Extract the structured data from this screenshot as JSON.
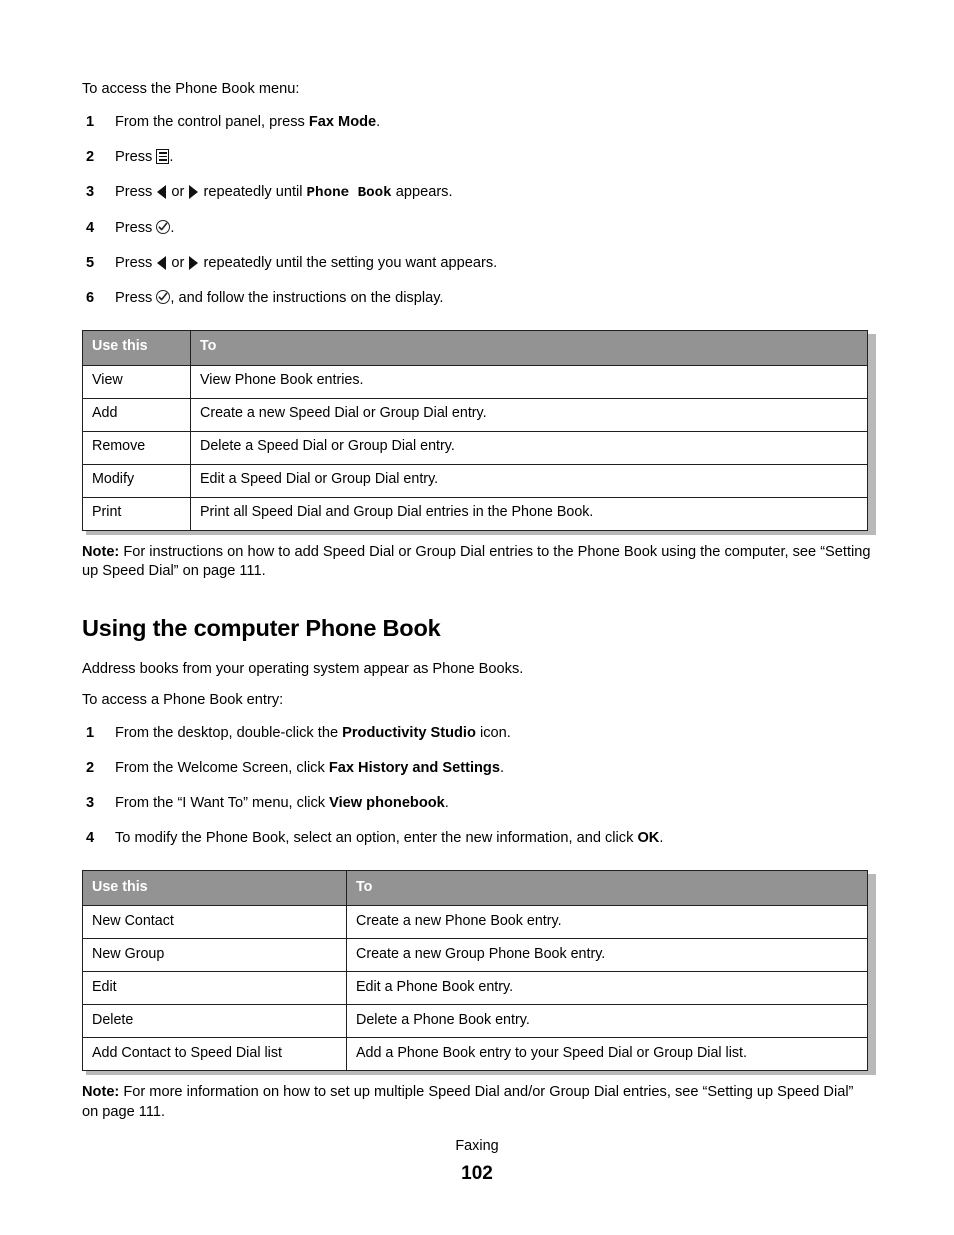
{
  "document": {
    "intro_line": "To access the Phone Book menu:",
    "footer_breadcrumb": "Faxing",
    "footer_page_number": "102",
    "header_fill_color": "#939393",
    "border_color": "#231f20"
  },
  "steps_panel": {
    "items": [
      {
        "num": "1",
        "parts": [
          {
            "type": "text",
            "value": "From the control panel, press "
          },
          {
            "type": "bold",
            "value": "Fax Mode"
          },
          {
            "type": "text",
            "value": "."
          }
        ]
      },
      {
        "num": "2",
        "parts": [
          {
            "type": "text",
            "value": "Press "
          },
          {
            "type": "icon",
            "value": "menu-icon"
          },
          {
            "type": "text",
            "value": "."
          }
        ]
      },
      {
        "num": "3",
        "parts": [
          {
            "type": "text",
            "value": "Press "
          },
          {
            "type": "icon",
            "value": "arrow-left-icon"
          },
          {
            "type": "text",
            "value": " or "
          },
          {
            "type": "icon",
            "value": "arrow-right-icon"
          },
          {
            "type": "text",
            "value": " repeatedly until "
          },
          {
            "type": "mono",
            "value": "Phone  Book"
          },
          {
            "type": "text",
            "value": " appears."
          }
        ]
      },
      {
        "num": "4",
        "parts": [
          {
            "type": "text",
            "value": "Press "
          },
          {
            "type": "icon",
            "value": "select-check-icon"
          },
          {
            "type": "text",
            "value": "."
          }
        ]
      },
      {
        "num": "5",
        "parts": [
          {
            "type": "text",
            "value": "Press "
          },
          {
            "type": "icon",
            "value": "arrow-left-icon"
          },
          {
            "type": "text",
            "value": " or "
          },
          {
            "type": "icon",
            "value": "arrow-right-icon"
          },
          {
            "type": "text",
            "value": " repeatedly until the setting you want appears."
          }
        ]
      },
      {
        "num": "6",
        "parts": [
          {
            "type": "text",
            "value": "Press "
          },
          {
            "type": "icon",
            "value": "select-check-icon"
          },
          {
            "type": "text",
            "value": ", and follow the instructions on the display."
          }
        ]
      }
    ]
  },
  "table_control_panel": {
    "columns": [
      "Use this",
      "To"
    ],
    "rows": [
      [
        "View",
        "View Phone Book entries."
      ],
      [
        "Add",
        "Create a new Speed Dial or Group Dial entry."
      ],
      [
        "Remove",
        "Delete a Speed Dial or Group Dial entry."
      ],
      [
        "Modify",
        "Edit a Speed Dial or Group Dial entry."
      ],
      [
        "Print",
        "Print all Speed Dial and Group Dial entries in the Phone Book."
      ]
    ]
  },
  "note_one": {
    "label": "Note:",
    "text": " For instructions on how to add Speed Dial or Group Dial entries to the Phone Book using the computer, see “Setting up Speed Dial” on page 111."
  },
  "section": {
    "title": "Using the computer Phone Book",
    "body_line": "Address books from your operating system appear as Phone Books.",
    "intro_line": "To access a Phone Book entry:"
  },
  "computer_steps_panel": {
    "items": [
      {
        "num": "1",
        "parts": [
          {
            "type": "text",
            "value": "From the desktop, double-click the "
          },
          {
            "type": "bold",
            "value": "Productivity Studio"
          },
          {
            "type": "text",
            "value": " icon."
          }
        ]
      },
      {
        "num": "2",
        "parts": [
          {
            "type": "text",
            "value": "From the Welcome Screen, click "
          },
          {
            "type": "bold",
            "value": "Fax History and Settings"
          },
          {
            "type": "text",
            "value": "."
          }
        ]
      },
      {
        "num": "3",
        "parts": [
          {
            "type": "text",
            "value": "From the “I Want To” menu, click "
          },
          {
            "type": "bold",
            "value": "View phonebook"
          },
          {
            "type": "text",
            "value": "."
          }
        ]
      },
      {
        "num": "4",
        "parts": [
          {
            "type": "text",
            "value": "To modify the Phone Book, select an option, enter the new information, and click "
          },
          {
            "type": "bold",
            "value": "OK"
          },
          {
            "type": "text",
            "value": "."
          }
        ]
      }
    ]
  },
  "table_computer_phonebook": {
    "columns": [
      "Use this",
      "To"
    ],
    "rows": [
      [
        "New Contact",
        "Create a new Phone Book entry."
      ],
      [
        "New Group",
        "Create a new Group Phone Book entry."
      ],
      [
        "Edit",
        "Edit a Phone Book entry."
      ],
      [
        "Delete",
        "Delete a Phone Book entry."
      ],
      [
        "Add Contact to Speed Dial list",
        "Add a Phone Book entry to your Speed Dial or Group Dial list."
      ]
    ]
  },
  "note_two": {
    "label": "Note:",
    "text": " For more information on how to set up multiple Speed Dial and/or Group Dial entries, see “Setting up Speed Dial” on page 111."
  }
}
